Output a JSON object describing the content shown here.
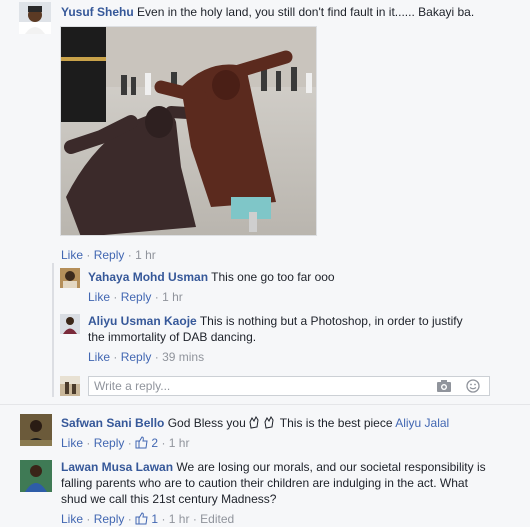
{
  "comments": [
    {
      "author": "Yusuf Shehu",
      "text": "Even in the holy land, you still don't find fault in it...... Bakayi ba.",
      "like_label": "Like",
      "reply_label": "Reply",
      "time": "1 hr"
    }
  ],
  "replies": [
    {
      "author": "Yahaya Mohd Usman",
      "text": "This one go too far ooo",
      "like_label": "Like",
      "reply_label": "Reply",
      "time": "1 hr"
    },
    {
      "author": "Aliyu Usman Kaoje",
      "text_line1": "This is nothing but a Photoshop, in order to justify",
      "text_line2": "the immortality of DAB dancing.",
      "like_label": "Like",
      "reply_label": "Reply",
      "time": "39 mins"
    }
  ],
  "reply_input": {
    "placeholder": "Write a reply..."
  },
  "comment2": {
    "author": "Safwan Sani Bello",
    "text_a": "God Bless you",
    "text_b": "This is the best piece",
    "mention": "Aliyu Jalal",
    "like_label": "Like",
    "reply_label": "Reply",
    "likes": "2",
    "time": "1 hr"
  },
  "comment3": {
    "author": "Lawan Musa Lawan",
    "text_line1": "We are losing our morals, and our societal responsibility is",
    "text_line2": "falling parents who are to caution their children are indulging in the act. What",
    "text_line3": "shud we call this 21st century Madness?",
    "like_label": "Like",
    "reply_label": "Reply",
    "likes": "1",
    "time": "1 hr",
    "edited": "Edited"
  },
  "colors": {
    "link": "#4267b2",
    "name": "#365899",
    "meta": "#90949c",
    "background": "#f6f7f9"
  },
  "icons": [
    "camera-icon",
    "emoji-icon",
    "thumbs-up-icon",
    "clapping-hands-emoji"
  ]
}
